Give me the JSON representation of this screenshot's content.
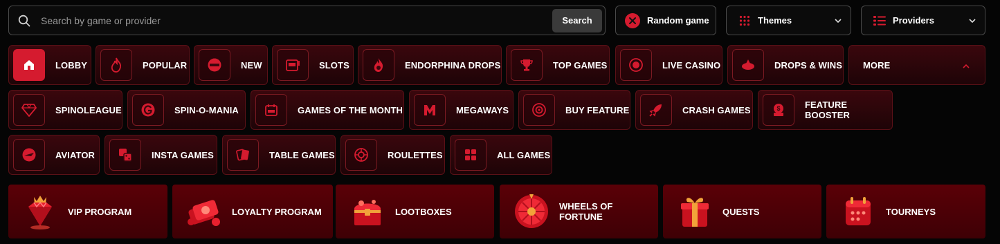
{
  "search": {
    "placeholder": "Search by game or provider",
    "value": "",
    "button_label": "Search"
  },
  "top_buttons": {
    "random": "Random game",
    "themes": "Themes",
    "providers": "Providers"
  },
  "categories": [
    {
      "label": "LOBBY",
      "icon": "home-icon"
    },
    {
      "label": "POPULAR",
      "icon": "flame-icon"
    },
    {
      "label": "NEW",
      "icon": "new-badge-icon"
    },
    {
      "label": "SLOTS",
      "icon": "slot-machine-icon"
    },
    {
      "label": "ENDORPHINA DROPS",
      "icon": "fire-drop-icon"
    },
    {
      "label": "TOP GAMES",
      "icon": "trophy-icon"
    },
    {
      "label": "LIVE CASINO",
      "icon": "live-icon"
    },
    {
      "label": "DROPS & WINS",
      "icon": "rocket-icon"
    },
    {
      "label": "MORE",
      "icon": "chevron-up-icon"
    },
    {
      "label": "SPINOLEAGUE",
      "icon": "diamond-icon"
    },
    {
      "label": "SPIN-O-MANIA",
      "icon": "g-coin-icon"
    },
    {
      "label": "GAMES OF THE MONTH",
      "icon": "calendar-icon"
    },
    {
      "label": "MEGAWAYS",
      "icon": "m-logo-icon"
    },
    {
      "label": "BUY FEATURE",
      "icon": "target-icon"
    },
    {
      "label": "CRASH GAMES",
      "icon": "crash-rocket-icon"
    },
    {
      "label": "FEATURE BOOSTER",
      "icon": "booster-icon"
    },
    {
      "label": "AVIATOR",
      "icon": "plane-icon"
    },
    {
      "label": "INSTA GAMES",
      "icon": "dice-icon"
    },
    {
      "label": "TABLE GAMES",
      "icon": "cards-icon"
    },
    {
      "label": "ROULETTES",
      "icon": "roulette-icon"
    },
    {
      "label": "ALL GAMES",
      "icon": "grid-icon"
    }
  ],
  "promos": [
    {
      "label": "VIP PROGRAM",
      "icon": "vip-gem-icon"
    },
    {
      "label": "LOYALTY PROGRAM",
      "icon": "loyalty-coins-icon"
    },
    {
      "label": "LOOTBOXES",
      "icon": "treasure-chest-icon"
    },
    {
      "label": "WHEELS OF FORTUNE",
      "icon": "fortune-wheel-icon"
    },
    {
      "label": "QUESTS",
      "icon": "gift-icon"
    },
    {
      "label": "TOURNEYS",
      "icon": "tourney-calendar-icon"
    }
  ],
  "colors": {
    "accent": "#d51b2f",
    "chip_bg": "#2c060a",
    "promo_bg": "#4d0006",
    "page_bg": "#050505"
  }
}
